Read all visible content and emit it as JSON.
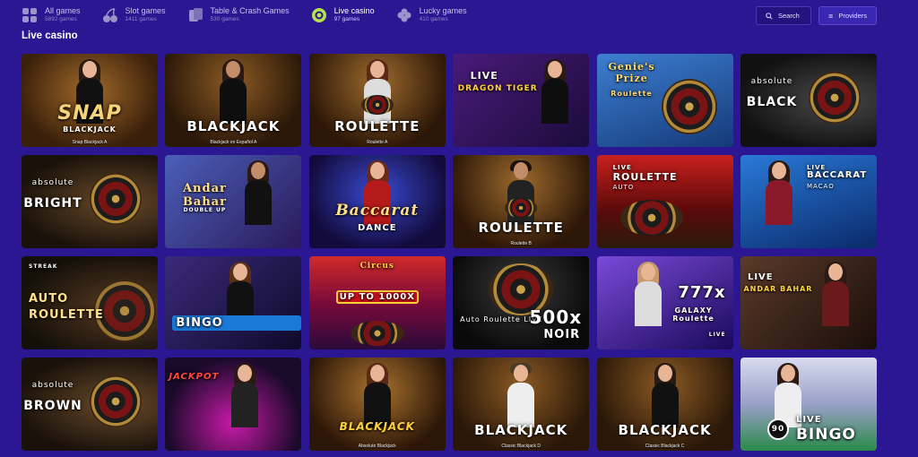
{
  "categories": [
    {
      "name": "All games",
      "count": "5892 games",
      "icon": "grid-icon",
      "active": false
    },
    {
      "name": "Slot games",
      "count": "1411 games",
      "icon": "cherries-icon",
      "active": false
    },
    {
      "name": "Table & Crash Games",
      "count": "530 games",
      "icon": "cards-icon",
      "active": false
    },
    {
      "name": "Live casino",
      "count": "97 games",
      "icon": "live-chip-icon",
      "active": true
    },
    {
      "name": "Lucky games",
      "count": "410 games",
      "icon": "clover-icon",
      "active": false
    }
  ],
  "search": {
    "label": "Search"
  },
  "providers": {
    "label": "Providers"
  },
  "section": {
    "title": "Live casino"
  },
  "tiles": [
    {
      "logo": "SNAP",
      "sub": "BLACKJACK",
      "caption": "Snap Blackjack A"
    },
    {
      "logo": "BLACKJACK",
      "sub": "",
      "caption": "Blackjack en Español A"
    },
    {
      "logo": "ROULETTE",
      "sub": "",
      "caption": "Roulette A"
    },
    {
      "logo": "LIVE",
      "sub": "DRAGON TIGER",
      "caption": ""
    },
    {
      "logo": "Genie's Prize",
      "sub": "Roulette",
      "caption": ""
    },
    {
      "logo": "absolute",
      "sub": "BLACK",
      "caption": ""
    },
    {
      "logo": "absolute",
      "sub": "BRIGHT",
      "caption": ""
    },
    {
      "logo": "Andar Bahar",
      "sub": "DOUBLE UP",
      "caption": ""
    },
    {
      "logo": "Baccarat",
      "sub": "DANCE",
      "caption": ""
    },
    {
      "logo": "ROULETTE",
      "sub": "",
      "caption": "Roulette B"
    },
    {
      "logo": "LIVE",
      "sub": "ROULETTE",
      "caption": "AUTO"
    },
    {
      "logo": "LIVE",
      "sub": "BACCARAT",
      "caption": "MACAO"
    },
    {
      "logo": "AUTO",
      "sub": "ROULETTE",
      "caption": "STREAK"
    },
    {
      "logo": "BINGO",
      "sub": "",
      "caption": ""
    },
    {
      "logo": "Circus",
      "sub": "UP TO 1000X",
      "caption": ""
    },
    {
      "logo": "500x",
      "sub": "NOIR",
      "caption": "Auto Roulette LIVE"
    },
    {
      "logo": "777x",
      "sub": "GALAXY Roulette",
      "caption": "LIVE"
    },
    {
      "logo": "LIVE",
      "sub": "ANDAR BAHAR",
      "caption": ""
    },
    {
      "logo": "absolute",
      "sub": "BROWN",
      "caption": ""
    },
    {
      "logo": "JACKPOT",
      "sub": "",
      "caption": ""
    },
    {
      "logo": "BLACKJACK",
      "sub": "",
      "caption": "Absolute Blackjack"
    },
    {
      "logo": "BLACKJACK",
      "sub": "",
      "caption": "Classic Blackjack D"
    },
    {
      "logo": "BLACKJACK",
      "sub": "",
      "caption": "Classic Blackjack C"
    },
    {
      "logo": "LIVE",
      "sub": "BINGO",
      "caption": "90"
    }
  ]
}
